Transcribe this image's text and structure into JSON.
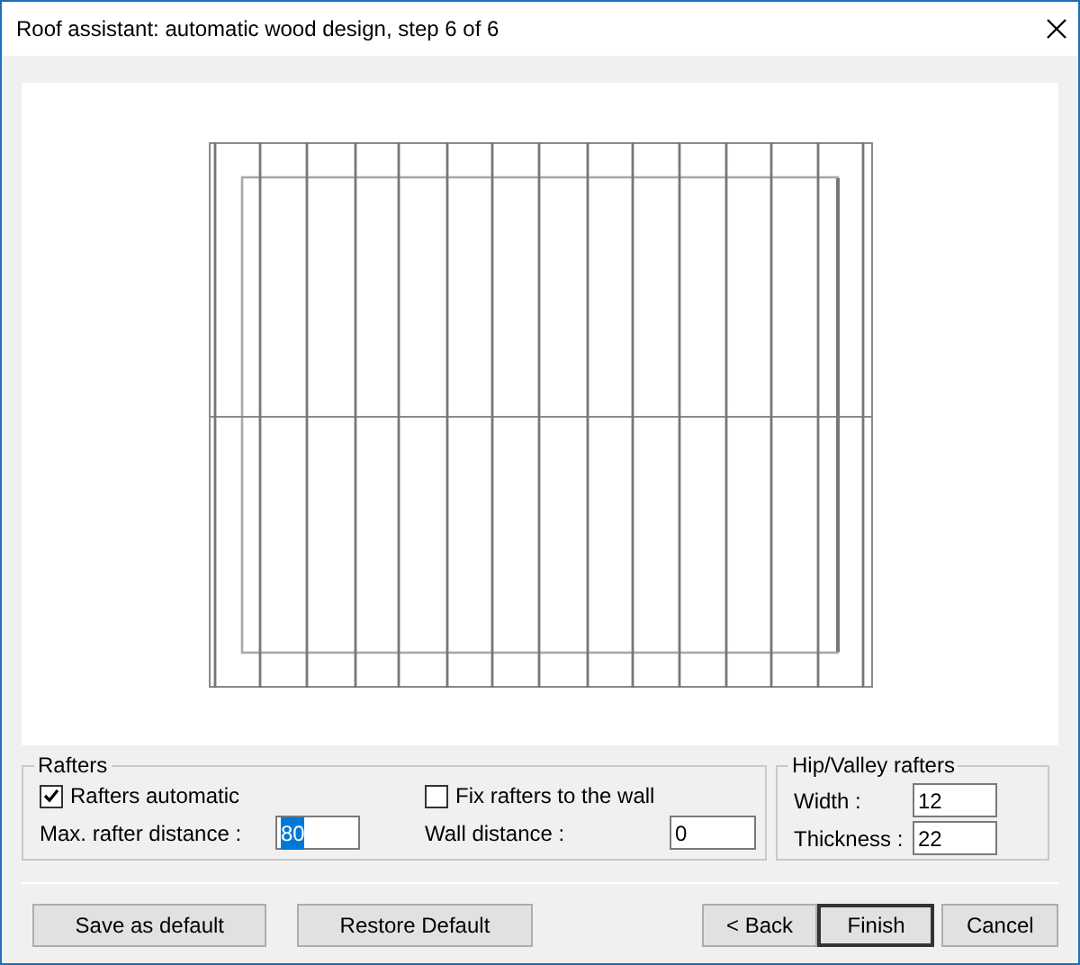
{
  "window": {
    "title": "Roof assistant: automatic wood design, step 6 of 6"
  },
  "rafters": {
    "title": "Rafters",
    "checkboxes": [
      {
        "label": "Rafters automatic",
        "checked": true
      },
      {
        "label": "Fix rafters to the wall",
        "checked": false
      }
    ],
    "fields": [
      {
        "label": "Max. rafter distance :",
        "value": "80",
        "text_selected": true
      },
      {
        "label": "Wall distance :",
        "value": "0",
        "text_selected": false
      }
    ]
  },
  "hip_valley": {
    "title": "Hip/Valley rafters",
    "fields": [
      {
        "label": "Width :",
        "value": "12"
      },
      {
        "label": "Thickness :",
        "value": "22"
      }
    ]
  },
  "buttons": [
    {
      "label": "Save as default",
      "default": false
    },
    {
      "label": "Restore Default",
      "default": false
    },
    {
      "label": "< Back",
      "default": false
    },
    {
      "label": "Finish",
      "default": true
    },
    {
      "label": "Cancel",
      "default": false
    }
  ]
}
